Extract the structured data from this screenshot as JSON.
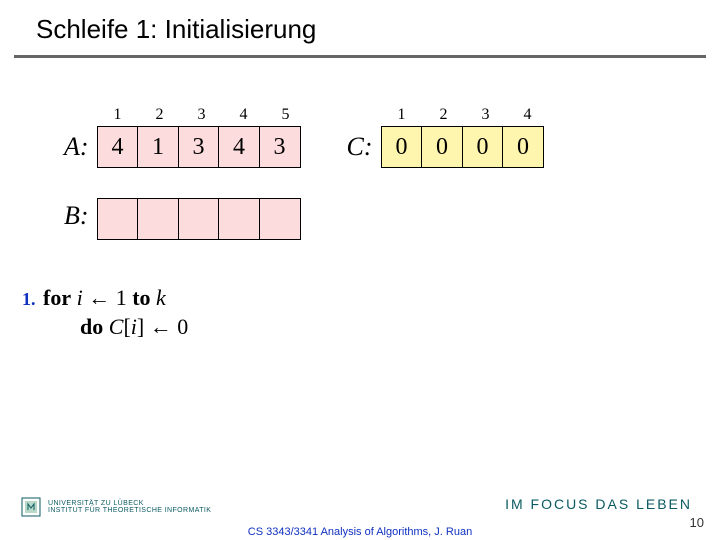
{
  "title": "Schleife 1: Initialisierung",
  "arrays": {
    "A": {
      "label": "A:",
      "indices": [
        "1",
        "2",
        "3",
        "4",
        "5"
      ],
      "values": [
        "4",
        "1",
        "3",
        "4",
        "3"
      ]
    },
    "C": {
      "label": "C:",
      "indices": [
        "1",
        "2",
        "3",
        "4"
      ],
      "values": [
        "0",
        "0",
        "0",
        "0"
      ]
    },
    "B": {
      "label": "B:",
      "values": [
        "",
        "",
        "",
        "",
        ""
      ]
    }
  },
  "pseudocode": {
    "linenum": "1.",
    "line1_for": "for",
    "line1_var": "i",
    "line1_arrow": "←",
    "line1_one": "1",
    "line1_to": "to",
    "line1_k": "k",
    "line2_do": "do",
    "line2_C": "C",
    "line2_bracket_open": "[",
    "line2_i": "i",
    "line2_bracket_close": "]",
    "line2_arrow": "←",
    "line2_zero": "0"
  },
  "footer": {
    "uni_line1": "UNIVERSITÄT ZU LÜBECK",
    "uni_line2": "INSTITUT FÜR THEORETISCHE INFORMATIK",
    "tagline": "IM FOCUS DAS LEBEN",
    "page_number": "10",
    "attribution": "CS 3343/3341 Analysis of Algorithms, J. Ruan"
  }
}
